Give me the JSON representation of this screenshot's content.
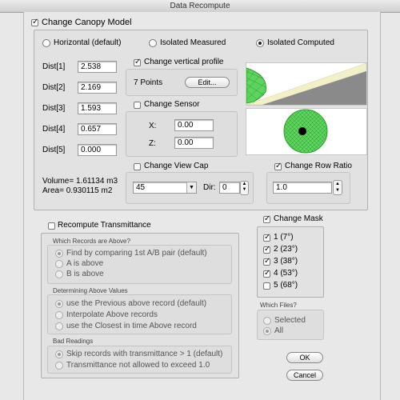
{
  "window": {
    "title": "Data Recompute"
  },
  "canopy": {
    "label": "Change Canopy Model",
    "checked": true,
    "models": [
      {
        "label": "Horizontal (default)",
        "selected": false
      },
      {
        "label": "Isolated Measured",
        "selected": false
      },
      {
        "label": "Isolated Computed",
        "selected": true
      }
    ],
    "dists": [
      {
        "label": "Dist[1]",
        "value": "2.538"
      },
      {
        "label": "Dist[2]",
        "value": "2.169"
      },
      {
        "label": "Dist[3]",
        "value": "1.593"
      },
      {
        "label": "Dist[4]",
        "value": "0.657"
      },
      {
        "label": "Dist[5]",
        "value": "0.000"
      }
    ],
    "volume": "Volume= 1.61134 m3",
    "area": "Area= 0.930115 m2",
    "vertical_profile": {
      "label": "Change vertical profile",
      "checked": true,
      "points": "7 Points",
      "edit_label": "Edit..."
    },
    "sensor": {
      "label": "Change Sensor",
      "checked": false,
      "x_label": "X:",
      "x_value": "0.00",
      "z_label": "Z:",
      "z_value": "0.00"
    },
    "view_cap": {
      "label": "Change View Cap",
      "checked": false,
      "value": "45",
      "dir_label": "Dir:",
      "dir_value": "0"
    },
    "row_ratio": {
      "label": "Change Row Ratio",
      "checked": true,
      "value": "1.0"
    }
  },
  "transmittance": {
    "label": "Recompute Transmittance",
    "checked": false,
    "records_above": {
      "header": "Which Records are Above?",
      "options": [
        {
          "label": "Find by comparing 1st A/B pair (default)",
          "selected": true
        },
        {
          "label": "A is above",
          "selected": false
        },
        {
          "label": "B is above",
          "selected": false
        }
      ]
    },
    "above_values": {
      "header": "Determining Above Values",
      "options": [
        {
          "label": "use the Previous above record (default)",
          "selected": true
        },
        {
          "label": "Interpolate Above records",
          "selected": false
        },
        {
          "label": "use the Closest in time Above record",
          "selected": false
        }
      ]
    },
    "bad_readings": {
      "header": "Bad Readings",
      "options": [
        {
          "label": "Skip records with transmittance > 1 (default)",
          "selected": true
        },
        {
          "label": "Transmittance not allowed to exceed 1.0",
          "selected": false
        }
      ]
    }
  },
  "mask": {
    "label": "Change Mask",
    "checked": true,
    "items": [
      {
        "label": "1 (7°)",
        "checked": true
      },
      {
        "label": "2 (23°)",
        "checked": true
      },
      {
        "label": "3 (38°)",
        "checked": true
      },
      {
        "label": "4 (53°)",
        "checked": true
      },
      {
        "label": "5 (68°)",
        "checked": false
      }
    ]
  },
  "files": {
    "header": "Which Files?",
    "options": [
      {
        "label": "Selected",
        "selected": false
      },
      {
        "label": "All",
        "selected": true
      }
    ]
  },
  "buttons": {
    "ok": "OK",
    "cancel": "Cancel"
  },
  "colors": {
    "canopy_fill": "#5fd35f",
    "canopy_edge": "#2e9e2e",
    "wedge": "#f2f0c8"
  }
}
